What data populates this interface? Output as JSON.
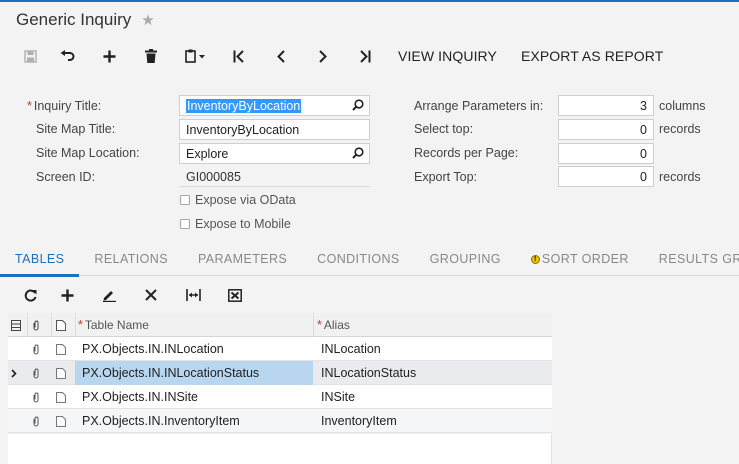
{
  "page": {
    "title": "Generic Inquiry"
  },
  "toolbar": {
    "view_inquiry": "VIEW INQUIRY",
    "export_as_report": "EXPORT AS REPORT"
  },
  "form": {
    "inquiry_title_label": "Inquiry Title:",
    "inquiry_title_value": "InventoryByLocation",
    "site_map_title_label": "Site Map Title:",
    "site_map_title_value": "InventoryByLocation",
    "site_map_location_label": "Site Map Location:",
    "site_map_location_value": "Explore",
    "screen_id_label": "Screen ID:",
    "screen_id_value": "GI000085",
    "expose_odata_label": "Expose via OData",
    "expose_mobile_label": "Expose to Mobile",
    "arrange_label": "Arrange Parameters in:",
    "arrange_value": "3",
    "arrange_unit": "columns",
    "select_top_label": "Select top:",
    "select_top_value": "0",
    "select_top_unit": "records",
    "records_per_page_label": "Records per Page:",
    "records_per_page_value": "0",
    "export_top_label": "Export Top:",
    "export_top_value": "0",
    "export_top_unit": "records"
  },
  "tabs": [
    {
      "label": "TABLES"
    },
    {
      "label": "RELATIONS"
    },
    {
      "label": "PARAMETERS"
    },
    {
      "label": "CONDITIONS"
    },
    {
      "label": "GROUPING"
    },
    {
      "label": "SORT ORDER"
    },
    {
      "label": "RESULTS GRID"
    }
  ],
  "grid": {
    "headers": {
      "table_name": "Table Name",
      "alias": "Alias"
    },
    "rows": [
      {
        "table_name": "PX.Objects.IN.INLocation",
        "alias": "INLocation"
      },
      {
        "table_name": "PX.Objects.IN.INLocationStatus",
        "alias": "INLocationStatus"
      },
      {
        "table_name": "PX.Objects.IN.INSite",
        "alias": "INSite"
      },
      {
        "table_name": "PX.Objects.IN.InventoryItem",
        "alias": "InventoryItem"
      }
    ]
  },
  "icons": {
    "save": "save-icon",
    "undo": "undo-icon",
    "add": "plus-icon",
    "delete": "trash-icon",
    "copy_paste": "clipboard-icon",
    "first": "first-page-icon",
    "prev": "chevron-left-icon",
    "next": "chevron-right-icon",
    "last": "last-page-icon",
    "favorite": "star-icon"
  },
  "colors": {
    "accent": "#1e6fbf",
    "selection": "#3399ff",
    "selected_row": "#b9d6f0",
    "warning": "#f2c200"
  }
}
